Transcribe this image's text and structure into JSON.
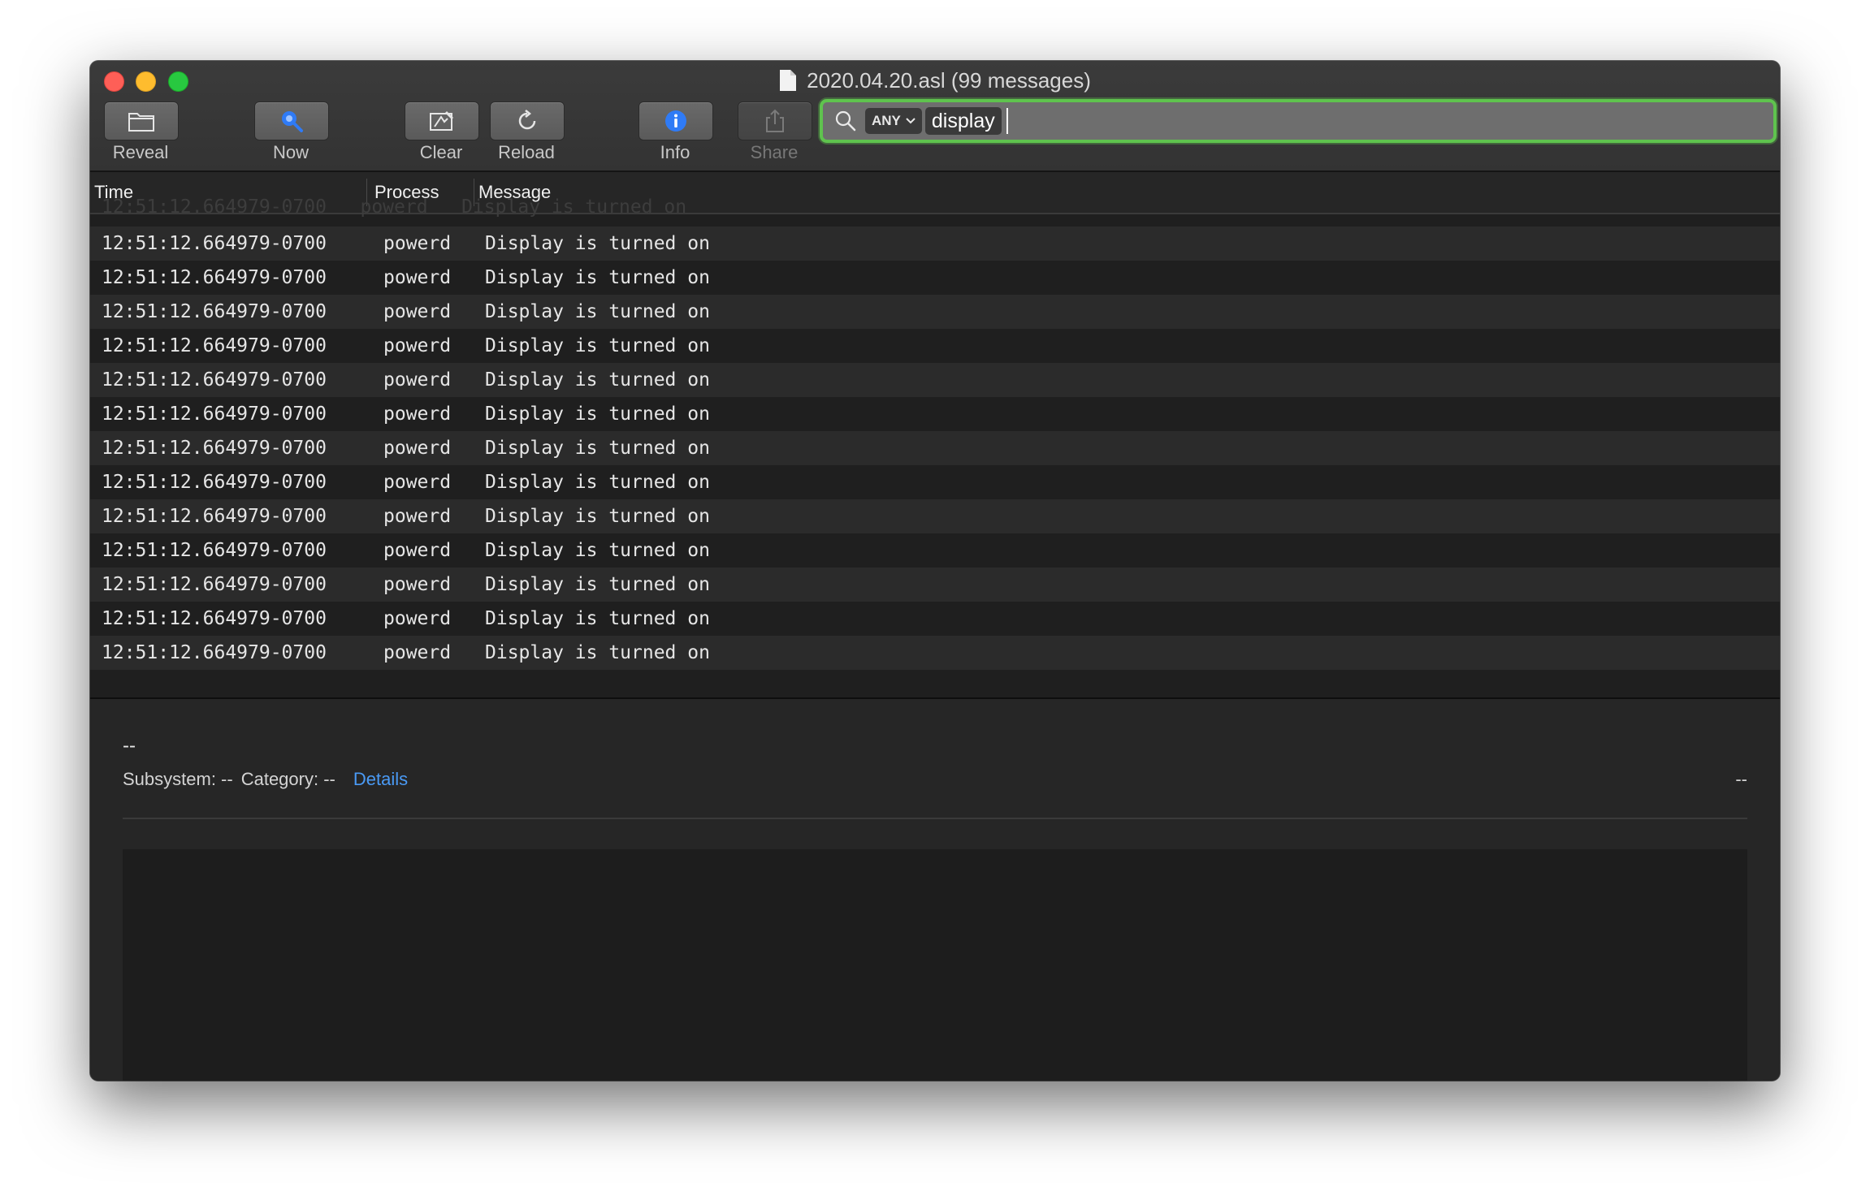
{
  "window": {
    "title": "2020.04.20.asl (99 messages)"
  },
  "toolbar": {
    "reveal_label": "Reveal",
    "now_label": "Now",
    "clear_label": "Clear",
    "reload_label": "Reload",
    "info_label": "Info",
    "share_label": "Share"
  },
  "search": {
    "scope": "ANY",
    "token": "display"
  },
  "table": {
    "columns": [
      "Time",
      "Process",
      "Message"
    ],
    "partial_row": "12:51:12.664979-0700   powerd   Display is turned on",
    "rows": [
      {
        "time": "12:51:12.664979-0700",
        "process": "powerd",
        "message": "Display is turned on"
      },
      {
        "time": "12:51:12.664979-0700",
        "process": "powerd",
        "message": "Display is turned on"
      },
      {
        "time": "12:51:12.664979-0700",
        "process": "powerd",
        "message": "Display is turned on"
      },
      {
        "time": "12:51:12.664979-0700",
        "process": "powerd",
        "message": "Display is turned on"
      },
      {
        "time": "12:51:12.664979-0700",
        "process": "powerd",
        "message": "Display is turned on"
      },
      {
        "time": "12:51:12.664979-0700",
        "process": "powerd",
        "message": "Display is turned on"
      },
      {
        "time": "12:51:12.664979-0700",
        "process": "powerd",
        "message": "Display is turned on"
      },
      {
        "time": "12:51:12.664979-0700",
        "process": "powerd",
        "message": "Display is turned on"
      },
      {
        "time": "12:51:12.664979-0700",
        "process": "powerd",
        "message": "Display is turned on"
      },
      {
        "time": "12:51:12.664979-0700",
        "process": "powerd",
        "message": "Display is turned on"
      },
      {
        "time": "12:51:12.664979-0700",
        "process": "powerd",
        "message": "Display is turned on"
      },
      {
        "time": "12:51:12.664979-0700",
        "process": "powerd",
        "message": "Display is turned on"
      },
      {
        "time": "12:51:12.664979-0700",
        "process": "powerd",
        "message": "Display is turned on"
      }
    ]
  },
  "detail": {
    "title": "--",
    "subsystem_label": "Subsystem: --",
    "category_label": "Category: --",
    "details_link": "Details",
    "right_value": "--"
  },
  "icons": {
    "reveal": "folder-icon",
    "now": "magnifier-now-icon",
    "clear": "clear-icon",
    "reload": "reload-icon",
    "info": "info-icon",
    "share": "share-icon",
    "search": "search-icon",
    "document": "document-icon"
  },
  "colors": {
    "search_focus": "#5fc34e",
    "info_accent": "#2f7bf6",
    "link": "#4a9af5"
  }
}
